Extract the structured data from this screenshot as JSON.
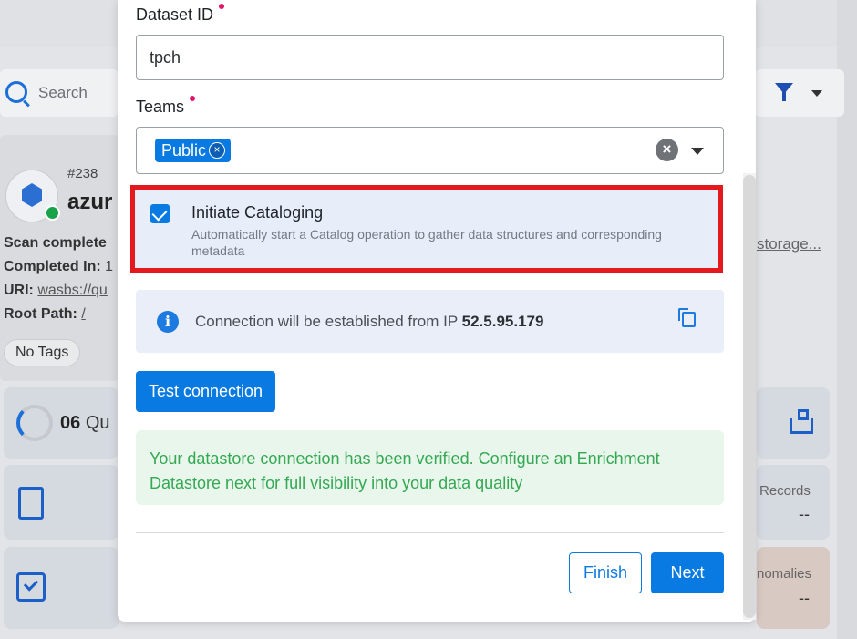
{
  "background": {
    "search_placeholder": "Search",
    "datastore_number": "#238",
    "datastore_name": "azur",
    "scan_label": "Scan complete",
    "completed_label": "Completed In:",
    "completed_value": "1",
    "uri_label": "URI:",
    "uri_value": "wasbs://qu",
    "root_label": "Root Path:",
    "root_value": "/",
    "tag": "No Tags",
    "storage_link": "storage...",
    "checks_count": "06",
    "checks_label": "Qu",
    "records_label": "Records",
    "records_value": "--",
    "anomalies_label": "nomalies",
    "anomalies_value": "--"
  },
  "form": {
    "dataset_label": "Dataset ID",
    "dataset_value": "tpch",
    "teams_label": "Teams",
    "team_chip": "Public",
    "team_chip_remove": "×",
    "teams_clear": "×",
    "catalog_title": "Initiate Cataloging",
    "catalog_desc": "Automatically start a Catalog operation to gather data structures and corresponding metadata",
    "catalog_checked": true,
    "info_msg": "Connection will be established from IP",
    "info_ip": "52.5.95.179",
    "info_icon": "i",
    "test_button": "Test connection",
    "success_msg": "Your datastore connection has been verified. Configure an Enrichment Datastore next for full visibility into your data quality",
    "finish_button": "Finish",
    "next_button": "Next"
  },
  "colors": {
    "primary": "#0a7ae3",
    "highlight_border": "#e3191e",
    "required": "#e0156b",
    "success_text": "#35a853"
  }
}
